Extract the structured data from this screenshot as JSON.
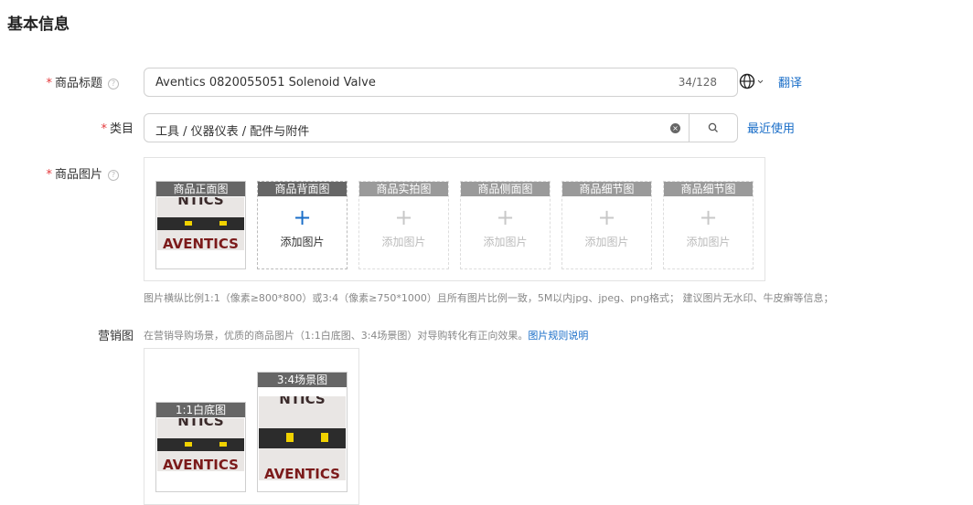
{
  "section": {
    "title": "基本信息"
  },
  "title_field": {
    "label": "商品标题",
    "value": "Aventics 0820055051 Solenoid Valve",
    "count": "34/128",
    "translate_label": "翻译",
    "globe_icon": "globe-icon"
  },
  "category_field": {
    "label": "类目",
    "value": "工具 / 仪器仪表 / 配件与附件",
    "recent_label": "最近使用",
    "clear_icon": "×",
    "search_icon": "search-icon"
  },
  "images_field": {
    "label": "商品图片",
    "slots": [
      {
        "header": "商品正面图",
        "has_image": true
      },
      {
        "header": "商品背面图",
        "add_label": "添加图片",
        "plus": "+"
      },
      {
        "header": "商品实拍图",
        "add_label": "添加图片",
        "plus": "+"
      },
      {
        "header": "商品侧面图",
        "add_label": "添加图片",
        "plus": "+"
      },
      {
        "header": "商品细节图",
        "add_label": "添加图片",
        "plus": "+"
      },
      {
        "header": "商品细节图",
        "add_label": "添加图片",
        "plus": "+"
      }
    ],
    "hint": "图片横纵比例1:1（像素≥800*800）或3:4（像素≥750*1000）且所有图片比例一致，5M以内jpg、jpeg、png格式； 建议图片无水印、牛皮癣等信息；"
  },
  "marketing_field": {
    "label": "营销图",
    "hint": "在营销导购场景，优质的商品图片（1:1白底图、3:4场景图）对导购转化有正向效果。",
    "rules_link": "图片规则说明",
    "slots": [
      {
        "header": "1:1白底图"
      },
      {
        "header": "3:4场景图"
      }
    ]
  },
  "photo": {
    "brand_text": "AVENTICS",
    "top_text": "NTICS"
  },
  "colors": {
    "accent": "#1a6ec8",
    "required": "#e4393c",
    "header_bg": "#666666"
  }
}
